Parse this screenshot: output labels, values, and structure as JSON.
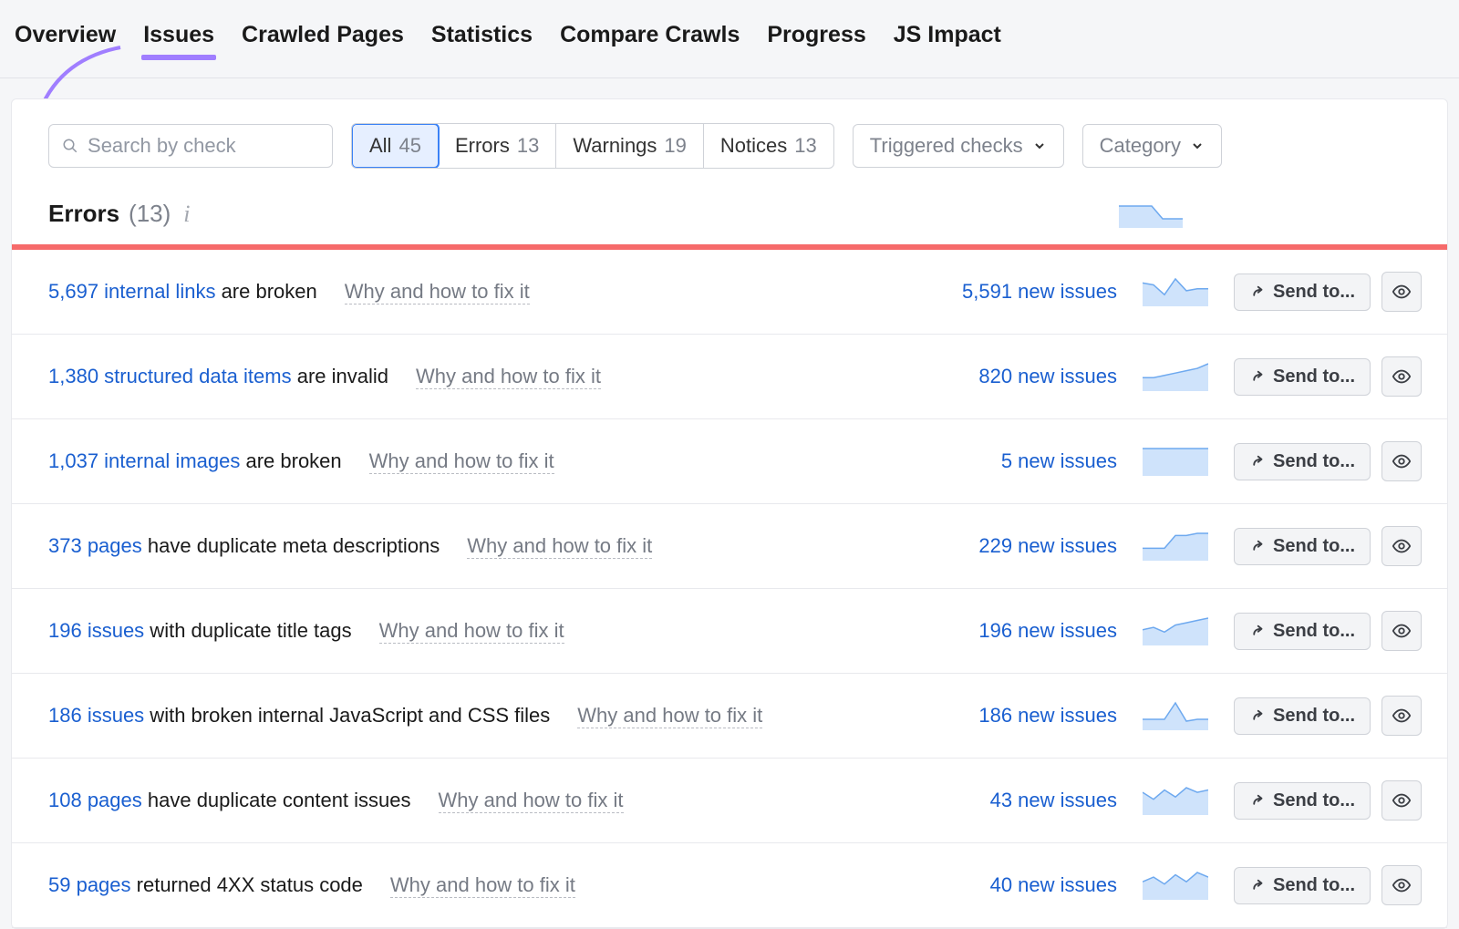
{
  "nav": {
    "tabs": [
      "Overview",
      "Issues",
      "Crawled Pages",
      "Statistics",
      "Compare Crawls",
      "Progress",
      "JS Impact"
    ],
    "active_index": 1
  },
  "toolbar": {
    "search_placeholder": "Search by check",
    "type_filters": [
      {
        "label": "All",
        "count": 45,
        "active": true
      },
      {
        "label": "Errors",
        "count": 13,
        "active": false
      },
      {
        "label": "Warnings",
        "count": 19,
        "active": false
      },
      {
        "label": "Notices",
        "count": 13,
        "active": false
      }
    ],
    "triggered_label": "Triggered checks",
    "category_label": "Category"
  },
  "section": {
    "title": "Errors",
    "count_text": "(13)"
  },
  "why_text": "Why and how to fix it",
  "sendto_text": "Send to...",
  "rows": [
    {
      "link": "5,697 internal links",
      "rest": " are broken",
      "new_issues": "5,591 new issues",
      "spark": [
        22,
        20,
        10,
        26,
        14,
        16,
        16
      ]
    },
    {
      "link": "1,380 structured data items",
      "rest": " are invalid",
      "new_issues": "820 new issues",
      "spark": [
        10,
        10,
        12,
        14,
        16,
        18,
        22
      ]
    },
    {
      "link": "1,037 internal images",
      "rest": " are broken",
      "new_issues": "5 new issues",
      "spark": [
        10,
        10,
        10,
        10,
        10,
        10,
        10
      ]
    },
    {
      "link": "373 pages",
      "rest": " have duplicate meta descriptions",
      "new_issues": "229 new issues",
      "spark": [
        10,
        10,
        10,
        22,
        22,
        24,
        24
      ]
    },
    {
      "link": "196 issues",
      "rest": " with duplicate title tags",
      "new_issues": "196 new issues",
      "spark": [
        12,
        14,
        10,
        16,
        18,
        20,
        22
      ]
    },
    {
      "link": "186 issues",
      "rest": " with broken internal JavaScript and CSS files",
      "new_issues": "186 new issues",
      "spark": [
        10,
        10,
        10,
        28,
        8,
        10,
        10
      ]
    },
    {
      "link": "108 pages",
      "rest": " have duplicate content issues",
      "new_issues": "43 new issues",
      "spark": [
        18,
        12,
        20,
        14,
        22,
        18,
        20
      ]
    },
    {
      "link": "59 pages",
      "rest": " returned 4XX status code",
      "new_issues": "40 new issues",
      "spark": [
        14,
        18,
        12,
        20,
        14,
        22,
        18
      ]
    }
  ],
  "chart_data": {
    "type": "line",
    "note": "small sparkline trend per issue row; y is relative recent issue count, no axis labels shown",
    "series_by_row_index": {
      "0": [
        22,
        20,
        10,
        26,
        14,
        16,
        16
      ],
      "1": [
        10,
        10,
        12,
        14,
        16,
        18,
        22
      ],
      "2": [
        10,
        10,
        10,
        10,
        10,
        10,
        10
      ],
      "3": [
        10,
        10,
        10,
        22,
        22,
        24,
        24
      ],
      "4": [
        12,
        14,
        10,
        16,
        18,
        20,
        22
      ],
      "5": [
        10,
        10,
        10,
        28,
        8,
        10,
        10
      ],
      "6": [
        18,
        12,
        20,
        14,
        22,
        18,
        20
      ],
      "7": [
        14,
        18,
        12,
        20,
        14,
        22,
        18
      ]
    }
  }
}
